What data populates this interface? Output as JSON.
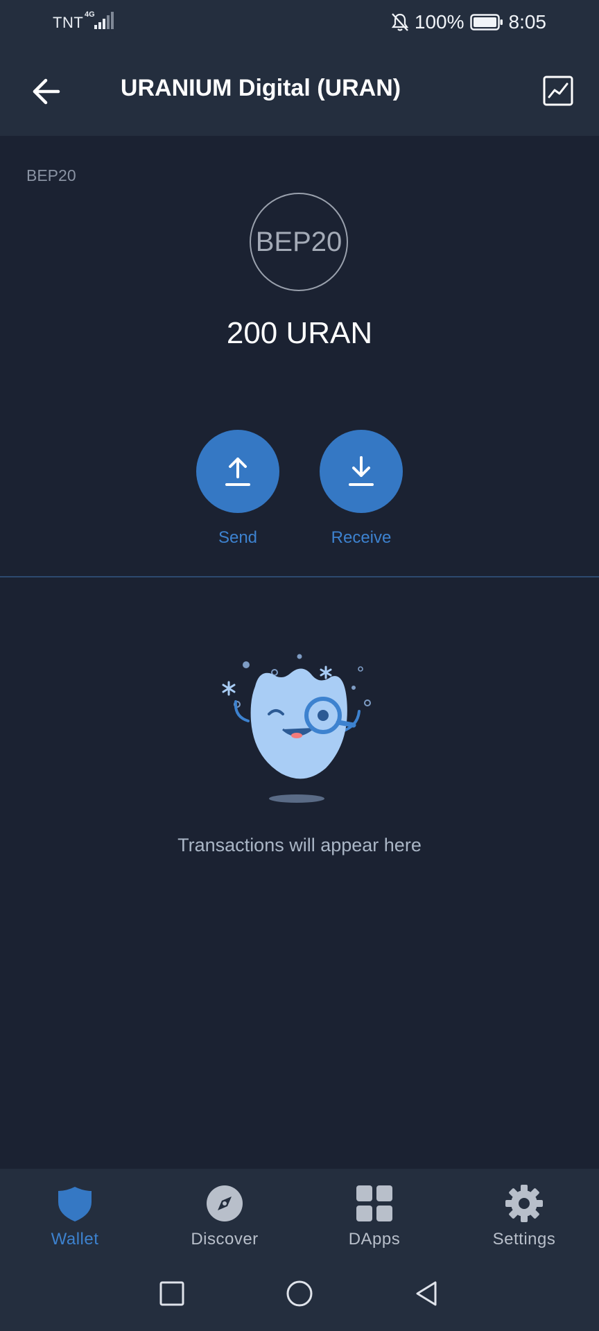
{
  "status_bar": {
    "carrier": "TNT",
    "network_type": "4G",
    "battery_percent": "100%",
    "time": "8:05"
  },
  "header": {
    "title": "URANIUM Digital (URAN)",
    "back_icon": "arrow-left-icon",
    "chart_icon": "line-chart-icon"
  },
  "token": {
    "network_label": "BEP20",
    "logo_text": "BEP20",
    "balance": "200 URAN"
  },
  "actions": {
    "send_label": "Send",
    "receive_label": "Receive"
  },
  "transactions": {
    "empty_text": "Transactions will appear here"
  },
  "bottom_nav": {
    "items": [
      {
        "label": "Wallet",
        "icon": "shield-icon",
        "active": true
      },
      {
        "label": "Discover",
        "icon": "compass-icon",
        "active": false
      },
      {
        "label": "DApps",
        "icon": "grid-icon",
        "active": false
      },
      {
        "label": "Settings",
        "icon": "gear-icon",
        "active": false
      }
    ]
  },
  "colors": {
    "background": "#1b2232",
    "bar": "#242e3e",
    "accent": "#3578c4",
    "accent_text": "#3d82cf"
  }
}
